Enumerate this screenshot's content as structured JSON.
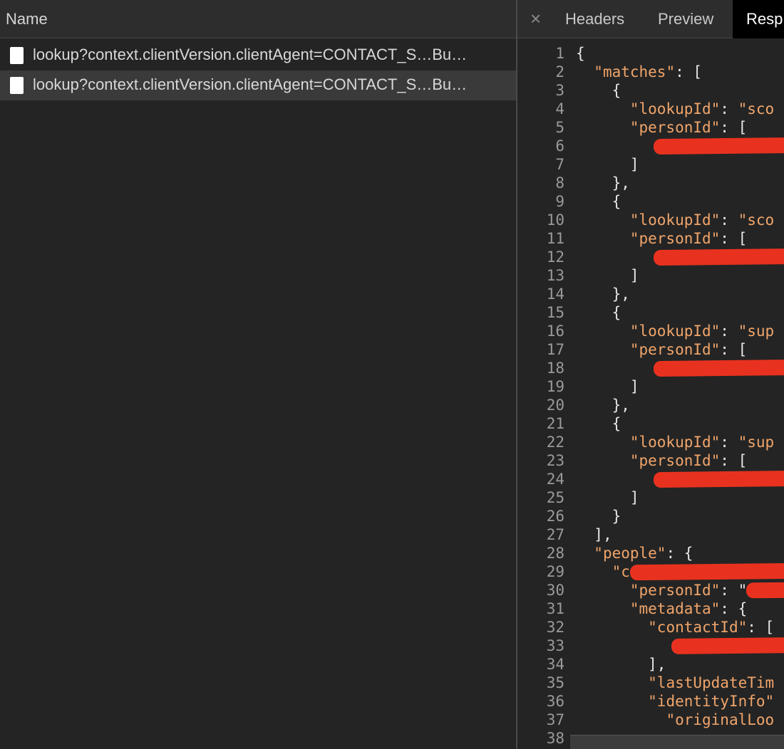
{
  "requests_panel": {
    "column_header": "Name",
    "rows": [
      {
        "name": "lookup?context.clientVersion.clientAgent=CONTACT_S…Bu…",
        "icon": "document-icon",
        "selected": false
      },
      {
        "name": "lookup?context.clientVersion.clientAgent=CONTACT_S…Bu…",
        "icon": "document-icon",
        "selected": true
      }
    ]
  },
  "detail_panel": {
    "close_icon": "×",
    "tabs": [
      {
        "label": "Headers"
      },
      {
        "label": "Preview"
      },
      {
        "label": "Resp",
        "active": true
      }
    ]
  },
  "response_lines": [
    {
      "n": "1",
      "indent": 0,
      "parts": [
        {
          "t": "{",
          "c": "p"
        }
      ]
    },
    {
      "n": "2",
      "indent": 1,
      "parts": [
        {
          "t": "\"matches\"",
          "c": "k"
        },
        {
          "t": ": [",
          "c": "p"
        }
      ]
    },
    {
      "n": "3",
      "indent": 2,
      "parts": [
        {
          "t": "{",
          "c": "p"
        }
      ]
    },
    {
      "n": "4",
      "indent": 3,
      "parts": [
        {
          "t": "\"lookupId\"",
          "c": "k"
        },
        {
          "t": ": ",
          "c": "p"
        },
        {
          "t": "\"sco",
          "c": "k"
        }
      ]
    },
    {
      "n": "5",
      "indent": 3,
      "parts": [
        {
          "t": "\"personId\"",
          "c": "k"
        },
        {
          "t": ": [",
          "c": "p"
        }
      ]
    },
    {
      "n": "6",
      "indent": 4,
      "parts": [],
      "redacted": true
    },
    {
      "n": "7",
      "indent": 3,
      "parts": [
        {
          "t": "]",
          "c": "p"
        }
      ]
    },
    {
      "n": "8",
      "indent": 2,
      "parts": [
        {
          "t": "},",
          "c": "p"
        }
      ]
    },
    {
      "n": "9",
      "indent": 2,
      "parts": [
        {
          "t": "{",
          "c": "p"
        }
      ]
    },
    {
      "n": "10",
      "indent": 3,
      "parts": [
        {
          "t": "\"lookupId\"",
          "c": "k"
        },
        {
          "t": ": ",
          "c": "p"
        },
        {
          "t": "\"sco",
          "c": "k"
        }
      ]
    },
    {
      "n": "11",
      "indent": 3,
      "parts": [
        {
          "t": "\"personId\"",
          "c": "k"
        },
        {
          "t": ": [",
          "c": "p"
        }
      ]
    },
    {
      "n": "12",
      "indent": 4,
      "parts": [],
      "redacted": true
    },
    {
      "n": "13",
      "indent": 3,
      "parts": [
        {
          "t": "]",
          "c": "p"
        }
      ]
    },
    {
      "n": "14",
      "indent": 2,
      "parts": [
        {
          "t": "},",
          "c": "p"
        }
      ]
    },
    {
      "n": "15",
      "indent": 2,
      "parts": [
        {
          "t": "{",
          "c": "p"
        }
      ]
    },
    {
      "n": "16",
      "indent": 3,
      "parts": [
        {
          "t": "\"lookupId\"",
          "c": "k"
        },
        {
          "t": ": ",
          "c": "p"
        },
        {
          "t": "\"sup",
          "c": "k"
        }
      ]
    },
    {
      "n": "17",
      "indent": 3,
      "parts": [
        {
          "t": "\"personId\"",
          "c": "k"
        },
        {
          "t": ": [",
          "c": "p"
        }
      ]
    },
    {
      "n": "18",
      "indent": 4,
      "parts": [],
      "redacted": true
    },
    {
      "n": "19",
      "indent": 3,
      "parts": [
        {
          "t": "]",
          "c": "p"
        }
      ]
    },
    {
      "n": "20",
      "indent": 2,
      "parts": [
        {
          "t": "},",
          "c": "p"
        }
      ]
    },
    {
      "n": "21",
      "indent": 2,
      "parts": [
        {
          "t": "{",
          "c": "p"
        }
      ]
    },
    {
      "n": "22",
      "indent": 3,
      "parts": [
        {
          "t": "\"lookupId\"",
          "c": "k"
        },
        {
          "t": ": ",
          "c": "p"
        },
        {
          "t": "\"sup",
          "c": "k"
        }
      ]
    },
    {
      "n": "23",
      "indent": 3,
      "parts": [
        {
          "t": "\"personId\"",
          "c": "k"
        },
        {
          "t": ": [",
          "c": "p"
        }
      ]
    },
    {
      "n": "24",
      "indent": 4,
      "parts": [],
      "redacted": true
    },
    {
      "n": "25",
      "indent": 3,
      "parts": [
        {
          "t": "]",
          "c": "p"
        }
      ]
    },
    {
      "n": "26",
      "indent": 2,
      "parts": [
        {
          "t": "}",
          "c": "p"
        }
      ]
    },
    {
      "n": "27",
      "indent": 1,
      "parts": [
        {
          "t": "],",
          "c": "p"
        }
      ]
    },
    {
      "n": "28",
      "indent": 1,
      "parts": [
        {
          "t": "\"people\"",
          "c": "k"
        },
        {
          "t": ": {",
          "c": "p"
        }
      ]
    },
    {
      "n": "29",
      "indent": 2,
      "parts": [
        {
          "t": "\"c",
          "c": "k"
        }
      ],
      "redacted": true
    },
    {
      "n": "30",
      "indent": 3,
      "parts": [
        {
          "t": "\"personId\"",
          "c": "k"
        },
        {
          "t": ": \"",
          "c": "p"
        }
      ],
      "redacted": true
    },
    {
      "n": "31",
      "indent": 3,
      "parts": [
        {
          "t": "\"metadata\"",
          "c": "k"
        },
        {
          "t": ": {",
          "c": "p"
        }
      ]
    },
    {
      "n": "32",
      "indent": 4,
      "parts": [
        {
          "t": "\"contactId\"",
          "c": "k"
        },
        {
          "t": ": [",
          "c": "p"
        }
      ]
    },
    {
      "n": "33",
      "indent": 5,
      "parts": [],
      "redacted": true
    },
    {
      "n": "34",
      "indent": 4,
      "parts": [
        {
          "t": "],",
          "c": "p"
        }
      ]
    },
    {
      "n": "35",
      "indent": 4,
      "parts": [
        {
          "t": "\"lastUpdateTim",
          "c": "k"
        }
      ]
    },
    {
      "n": "36",
      "indent": 4,
      "parts": [
        {
          "t": "\"identityInfo\"",
          "c": "k"
        }
      ]
    },
    {
      "n": "37",
      "indent": 5,
      "parts": [
        {
          "t": "\"originalLoo",
          "c": "k"
        }
      ]
    },
    {
      "n": "38",
      "indent": 5,
      "parts": []
    }
  ],
  "colors": {
    "key": "#f0a56b",
    "punctuation": "#e6e6e6",
    "redaction": "#e8321f",
    "line_number": "#9a9a9a",
    "active_tab_bg": "#000000"
  }
}
